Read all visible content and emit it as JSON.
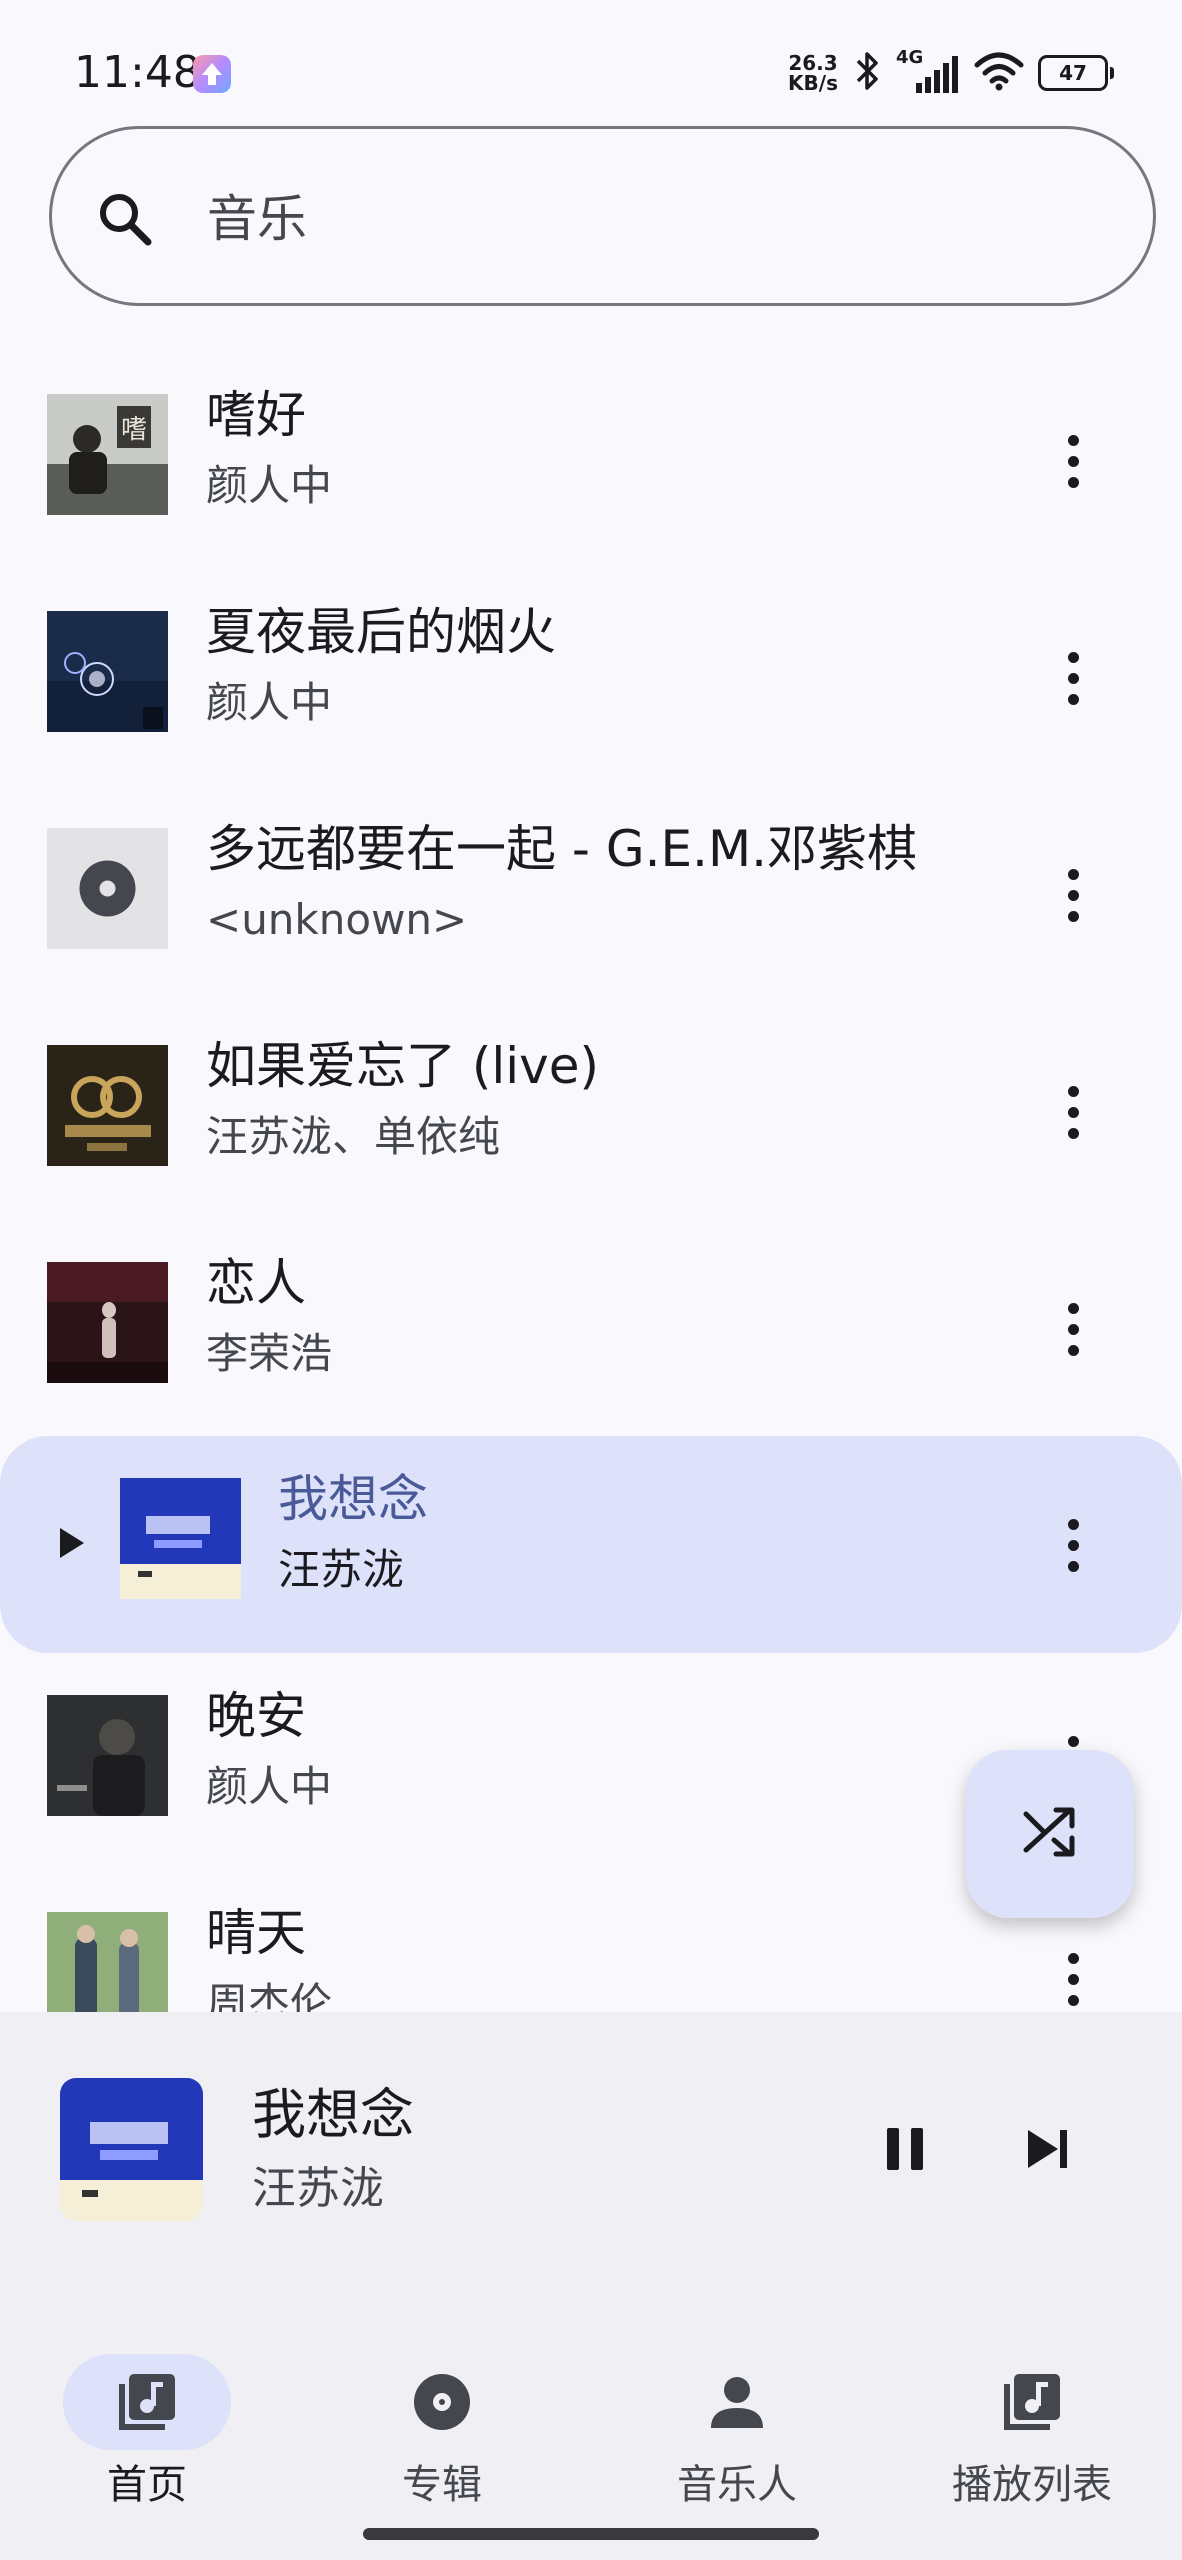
{
  "status_bar": {
    "time": "11:48",
    "net_speed_value": "26.3",
    "net_speed_unit": "KB/s",
    "network_type": "4G",
    "battery": "47",
    "icons": [
      "app-update-icon",
      "bluetooth-icon",
      "signal-icon",
      "wifi-icon",
      "battery-icon"
    ]
  },
  "search": {
    "query": "音乐",
    "icon": "search-icon"
  },
  "songs": [
    {
      "title": "嗜好",
      "artist": "颜人中",
      "art": "album-art",
      "playing": false
    },
    {
      "title": "夏夜最后的烟火",
      "artist": "颜人中",
      "art": "album-art",
      "playing": false
    },
    {
      "title": "多远都要在一起 - G.E.M.邓紫棋",
      "artist": "<unknown>",
      "art": "disc-placeholder-icon",
      "playing": false
    },
    {
      "title": "如果爱忘了 (live)",
      "artist": "汪苏泷、单依纯",
      "art": "album-art",
      "playing": false
    },
    {
      "title": "恋人",
      "artist": "李荣浩",
      "art": "album-art",
      "playing": false
    },
    {
      "title": "我想念",
      "artist": "汪苏泷",
      "art": "album-art",
      "playing": true
    },
    {
      "title": "晚安",
      "artist": "颜人中",
      "art": "album-art",
      "playing": false
    },
    {
      "title": "晴天",
      "artist": "周杰伦",
      "art": "album-art",
      "playing": false
    }
  ],
  "fab": {
    "icon": "shuffle-icon"
  },
  "mini_player": {
    "title": "我想念",
    "artist": "汪苏泷",
    "pause_icon": "pause-icon",
    "next_icon": "skip-next-icon"
  },
  "bottom_nav": {
    "items": [
      {
        "label": "首页",
        "icon": "library-music-icon",
        "active": true
      },
      {
        "label": "专辑",
        "icon": "album-icon",
        "active": false
      },
      {
        "label": "音乐人",
        "icon": "person-icon",
        "active": false
      },
      {
        "label": "播放列表",
        "icon": "playlist-icon",
        "active": false
      }
    ]
  },
  "colors": {
    "background": "#f8f8fd",
    "accent_container": "#dde1f9",
    "current_title": "#4a5a98",
    "surface_variant": "#efeff4"
  }
}
